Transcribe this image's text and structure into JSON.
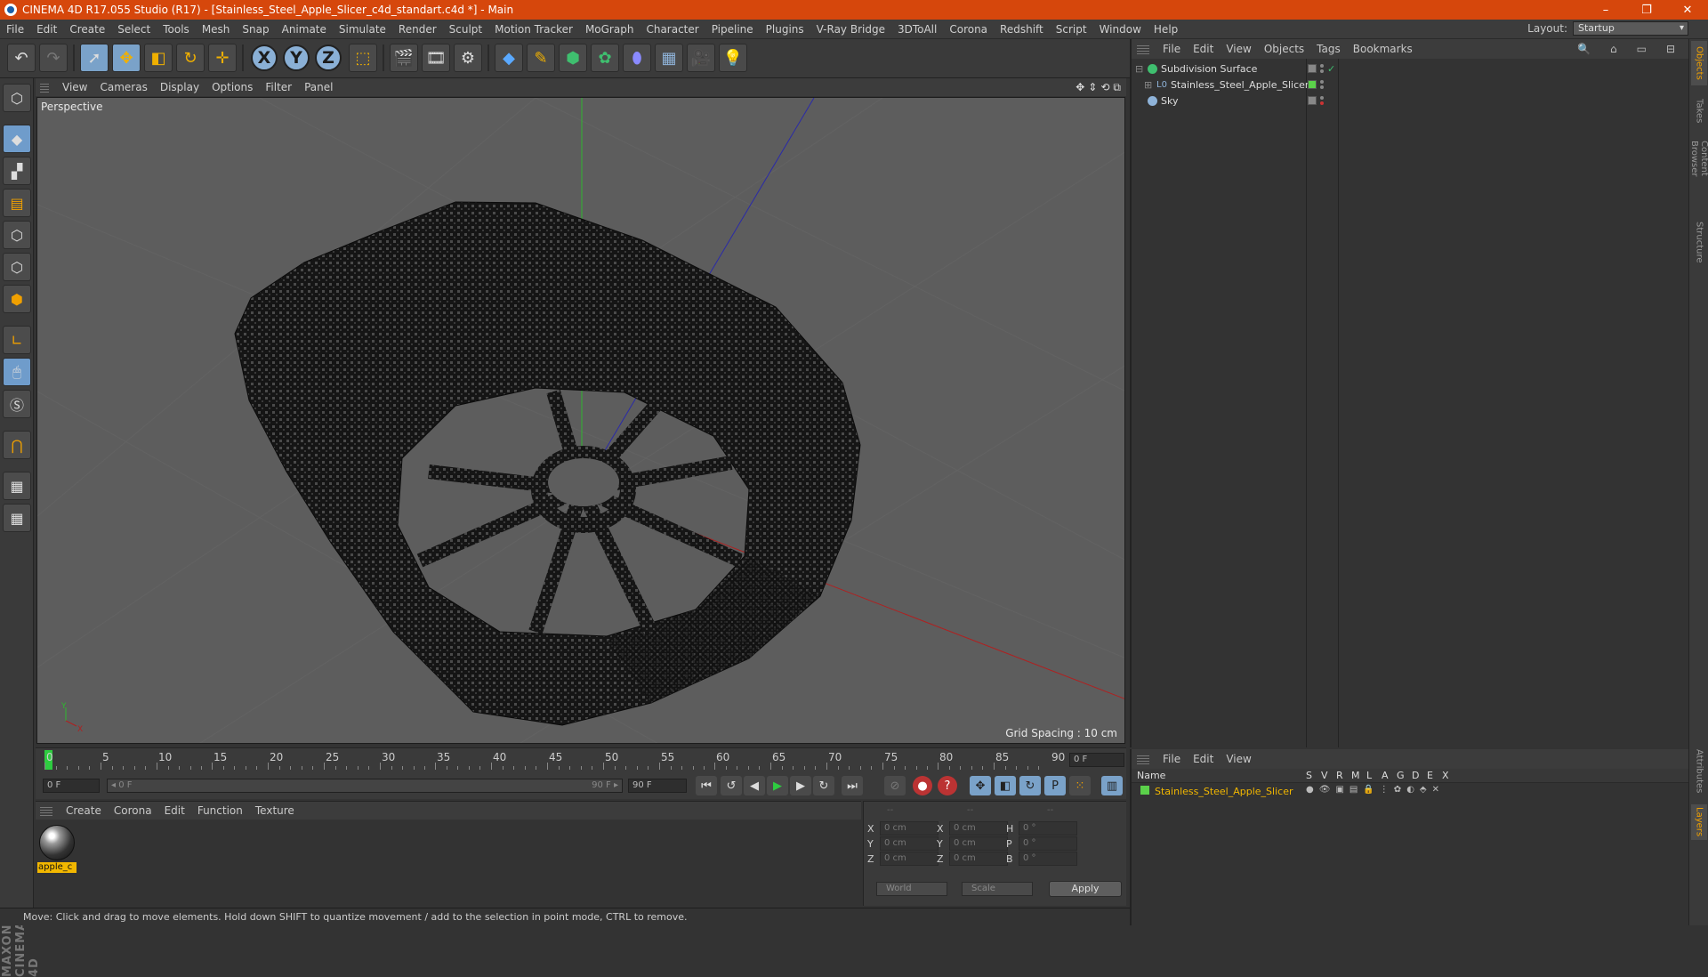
{
  "window": {
    "title": "CINEMA 4D R17.055 Studio (R17) - [Stainless_Steel_Apple_Slicer_c4d_standart.c4d *] - Main",
    "controls": {
      "minimize": "–",
      "restore": "❐",
      "close": "✕"
    }
  },
  "menubar": [
    "File",
    "Edit",
    "Create",
    "Select",
    "Tools",
    "Mesh",
    "Snap",
    "Animate",
    "Simulate",
    "Render",
    "Sculpt",
    "Motion Tracker",
    "MoGraph",
    "Character",
    "Pipeline",
    "Plugins",
    "V-Ray Bridge",
    "3DToAll",
    "Corona",
    "Redshift",
    "Script",
    "Window",
    "Help"
  ],
  "layout": {
    "label": "Layout:",
    "value": "Startup"
  },
  "toolbar": {
    "icons": [
      "undo-icon",
      "redo-icon",
      "select-icon",
      "move-icon",
      "scale-icon",
      "rotate-icon",
      "move-extra-icon",
      "x-axis-icon",
      "y-axis-icon",
      "z-axis-icon",
      "coordinate-system-icon",
      "render-view-icon",
      "render-picture-viewer-icon",
      "edit-render-settings-icon",
      "cube-icon",
      "pen-icon",
      "subdivision-icon",
      "cloner-icon",
      "deformer-icon",
      "floor-icon",
      "camera-icon",
      "light-icon"
    ],
    "axis_labels": [
      "X",
      "Y",
      "Z"
    ]
  },
  "viewport": {
    "menu": [
      "View",
      "Cameras",
      "Display",
      "Options",
      "Filter",
      "Panel"
    ],
    "label": "Perspective",
    "grid_spacing": "Grid Spacing : 10 cm",
    "axis_gizmo": {
      "y": "Y",
      "x": "X"
    }
  },
  "timeline": {
    "ticks": [
      "0",
      "5",
      "10",
      "15",
      "20",
      "25",
      "30",
      "35",
      "40",
      "45",
      "50",
      "55",
      "60",
      "65",
      "70",
      "75",
      "80",
      "85",
      "90"
    ],
    "current_frame_field": "0 F",
    "start_field": "0 F",
    "range_start": "◂ 0 F",
    "range_end": "90 F ▸",
    "end_field": "90 F"
  },
  "material_manager": {
    "menu": [
      "Create",
      "Corona",
      "Edit",
      "Function",
      "Texture"
    ],
    "materials": [
      {
        "name": "apple_c"
      }
    ]
  },
  "coordinates": {
    "header": [
      "--",
      "--",
      "--"
    ],
    "rows": [
      {
        "a": "X",
        "av": "0 cm",
        "b": "X",
        "bv": "0 cm",
        "c": "H",
        "cv": "0 °"
      },
      {
        "a": "Y",
        "av": "0 cm",
        "b": "Y",
        "bv": "0 cm",
        "c": "P",
        "cv": "0 °"
      },
      {
        "a": "Z",
        "av": "0 cm",
        "b": "Z",
        "bv": "0 cm",
        "c": "B",
        "cv": "0 °"
      }
    ],
    "mode": "World",
    "type": "Scale",
    "apply": "Apply"
  },
  "object_manager": {
    "menu": [
      "File",
      "Edit",
      "View",
      "Objects",
      "Tags",
      "Bookmarks"
    ],
    "objects": [
      {
        "name": "Subdivision Surface",
        "icon_color": "#3fbf6f"
      },
      {
        "name": "Stainless_Steel_Apple_Slicer",
        "icon_color": "#8fb3d9",
        "tag_color": "#5bd14a"
      },
      {
        "name": "Sky",
        "icon_color": "#8fb3d9"
      }
    ]
  },
  "layer_manager": {
    "menu": [
      "File",
      "Edit",
      "View"
    ],
    "columns": [
      "Name",
      "S",
      "V",
      "R",
      "M",
      "L",
      "A",
      "G",
      "D",
      "E",
      "X"
    ],
    "layers": [
      {
        "name": "Stainless_Steel_Apple_Slicer",
        "color": "#5bd14a"
      }
    ]
  },
  "right_tabs": [
    "Objects",
    "Takes",
    "Content Browser",
    "Structure",
    "Attributes",
    "Layers"
  ],
  "status": "Move: Click and drag to move elements. Hold down SHIFT to quantize movement / add to the selection in point mode, CTRL to remove.",
  "colors": {
    "titlebar": "#d6470c",
    "accent": "#f2b700",
    "timeline_cursor": "#2ecc40"
  }
}
